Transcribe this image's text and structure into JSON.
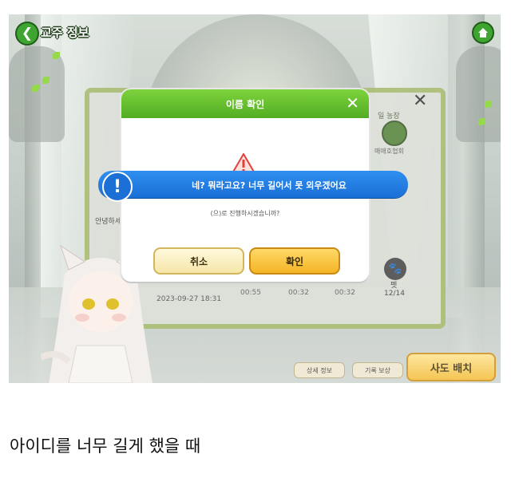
{
  "header": {
    "title": "교주 정보"
  },
  "panel": {
    "farm_name": "일 농장",
    "farm_sub": "매애호협회",
    "greeting": "안녕하세요",
    "date": "2023-09-27 18:31",
    "stats": [
      "00:55",
      "00:32",
      "00:32"
    ],
    "pet_label": "펫",
    "pet_count": "12/14"
  },
  "bottom": {
    "detail_label": "상세 정보",
    "record_label": "기록 보상",
    "deploy_label": "사도 배치"
  },
  "modal": {
    "title": "이름 확인",
    "close_glyph": "✕",
    "question": "(으)로 진행하시겠습니까?",
    "cancel_label": "취소",
    "confirm_label": "확인"
  },
  "toast": {
    "message": "네? 뭐라고요? 너무 길어서 못 외우겠어요"
  },
  "caption": "아이디를 너무 길게 했을 때",
  "colors": {
    "header_green": "#52ad22",
    "toast_blue": "#1a6fd6",
    "confirm_yellow": "#f3b425"
  },
  "icons": [
    "back-arrow-icon",
    "home-icon",
    "close-icon",
    "warning-icon",
    "info-icon",
    "paw-icon"
  ]
}
